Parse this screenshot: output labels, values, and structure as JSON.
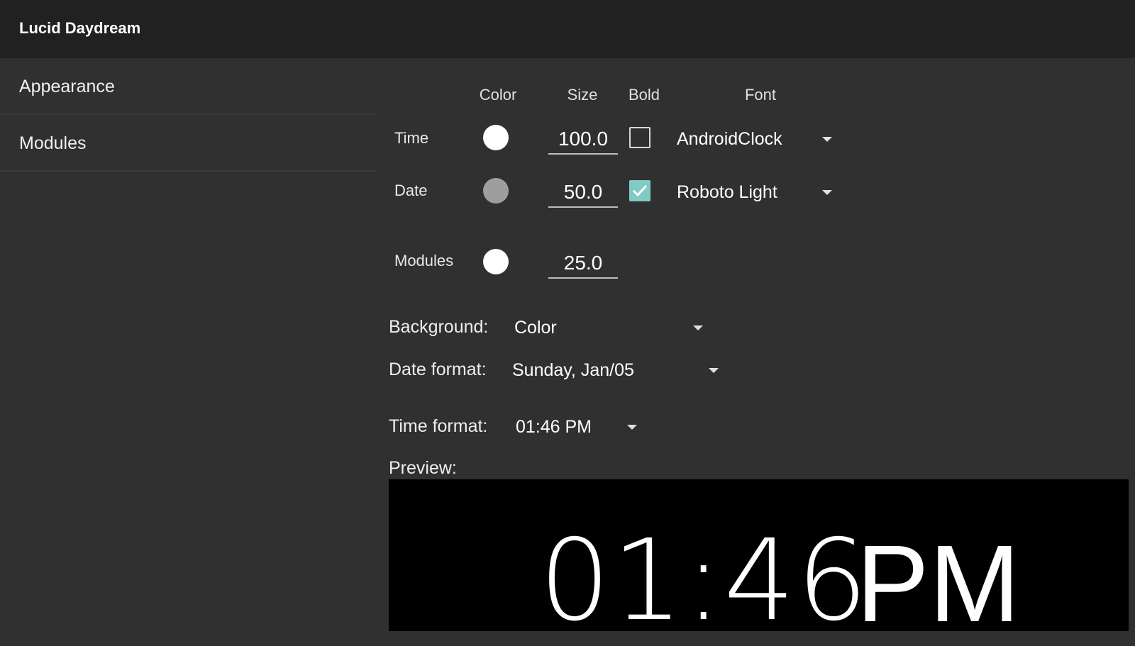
{
  "app": {
    "title": "Lucid Daydream"
  },
  "sidebar": {
    "items": [
      {
        "label": "Appearance"
      },
      {
        "label": "Modules"
      }
    ]
  },
  "table": {
    "headers": {
      "color": "Color",
      "size": "Size",
      "bold": "Bold",
      "font": "Font"
    },
    "rows": [
      {
        "label": "Time",
        "color": "#ffffff",
        "size": "100.0",
        "bold": false,
        "font": "AndroidClock"
      },
      {
        "label": "Date",
        "color": "#9e9e9e",
        "size": "50.0",
        "bold": true,
        "font": "Roboto Light"
      },
      {
        "label": "Modules",
        "color": "#ffffff",
        "size": "25.0"
      }
    ]
  },
  "settings": {
    "background": {
      "label": "Background:",
      "value": "Color"
    },
    "date_format": {
      "label": "Date format:",
      "value": "Sunday, Jan/05"
    },
    "time_format": {
      "label": "Time format:",
      "value": "01:46 PM"
    }
  },
  "preview": {
    "label": "Preview:",
    "time": "01:46",
    "ampm": "PM"
  },
  "colors": {
    "accent": "#80cbc4",
    "titlebar": "#212121",
    "background": "#303030"
  },
  "icons": {
    "dropdown": "caret-down-icon",
    "checkbox_checked": "checkmark-icon"
  }
}
